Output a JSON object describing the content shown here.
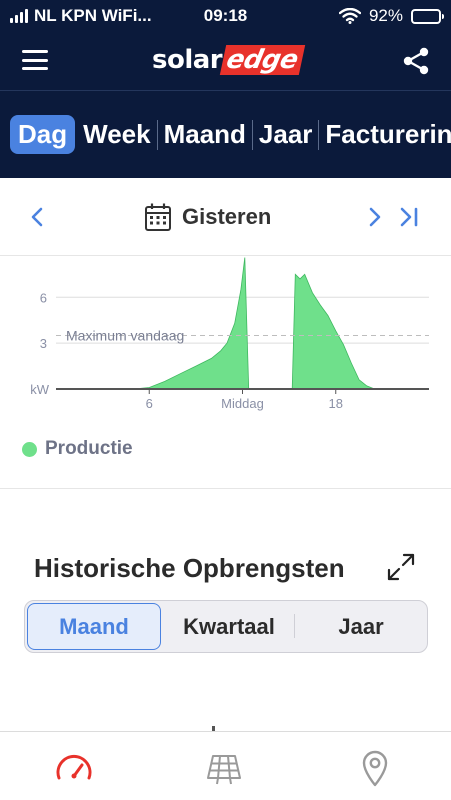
{
  "status_bar": {
    "carrier": "NL KPN WiFi...",
    "time": "09:18",
    "battery": "92%",
    "battery_level": 0.92
  },
  "app_bar": {
    "logo_solar": "solar",
    "logo_edge": "edge",
    "menu_icon": "hamburger-icon",
    "share_icon": "share-icon"
  },
  "tabs": [
    {
      "label": "Dag",
      "active": true
    },
    {
      "label": "Week",
      "active": false
    },
    {
      "label": "Maand",
      "active": false
    },
    {
      "label": "Jaar",
      "active": false
    },
    {
      "label": "Facturerin",
      "active": false
    }
  ],
  "date_nav": {
    "label": "Gisteren",
    "prev_icon": "chevron-left-icon",
    "next_icon": "chevron-right-icon",
    "last_icon": "skip-to-end-icon",
    "calendar_icon": "calendar-icon"
  },
  "chart_data": {
    "type": "area",
    "y_unit": "kW",
    "yticks": [
      6,
      3
    ],
    "ylim": [
      0,
      8.7
    ],
    "xlim": [
      0,
      24
    ],
    "xticks": [
      {
        "value": 6,
        "label": "6"
      },
      {
        "value": 12,
        "label": "Middag"
      },
      {
        "value": 18,
        "label": "18"
      }
    ],
    "reference_line": {
      "label": "Maximum vandaag",
      "value": 3.5
    },
    "series": [
      {
        "name": "Productie",
        "color": "#6fe08b",
        "points": [
          [
            5.0,
            0
          ],
          [
            6.0,
            0.1
          ],
          [
            7.0,
            0.5
          ],
          [
            8.0,
            1.0
          ],
          [
            9.0,
            1.5
          ],
          [
            10.0,
            2.0
          ],
          [
            10.6,
            2.5
          ],
          [
            11.0,
            3.0
          ],
          [
            11.5,
            4.3
          ],
          [
            11.9,
            6.5
          ],
          [
            12.15,
            8.6
          ],
          [
            12.4,
            0
          ],
          [
            15.2,
            0
          ],
          [
            15.4,
            7.5
          ],
          [
            15.7,
            7.2
          ],
          [
            16.0,
            7.5
          ],
          [
            16.5,
            6.3
          ],
          [
            17.0,
            5.5
          ],
          [
            17.5,
            4.8
          ],
          [
            18.0,
            3.8
          ],
          [
            18.5,
            2.9
          ],
          [
            19.0,
            1.7
          ],
          [
            19.5,
            0.6
          ],
          [
            20.0,
            0.2
          ],
          [
            20.5,
            0
          ]
        ]
      }
    ]
  },
  "legend": {
    "label": "Productie",
    "color": "#6fe08b"
  },
  "historic": {
    "title": "Historische Opbrengsten",
    "expand_icon": "expand-icon",
    "segments": [
      {
        "label": "Maand",
        "active": true
      },
      {
        "label": "Kwartaal",
        "active": false
      },
      {
        "label": "Jaar",
        "active": false
      }
    ]
  },
  "bottom_nav": [
    {
      "icon": "speedometer-icon",
      "active": true,
      "color": "#e8322b"
    },
    {
      "icon": "solar-panel-icon",
      "active": false,
      "color": "#9a9a9a"
    },
    {
      "icon": "location-pin-icon",
      "active": false,
      "color": "#9a9a9a"
    }
  ],
  "colors": {
    "navy": "#0b1a3b",
    "accent_blue": "#4a82e0",
    "brand_red": "#e8322b",
    "production_green": "#6fe08b"
  }
}
